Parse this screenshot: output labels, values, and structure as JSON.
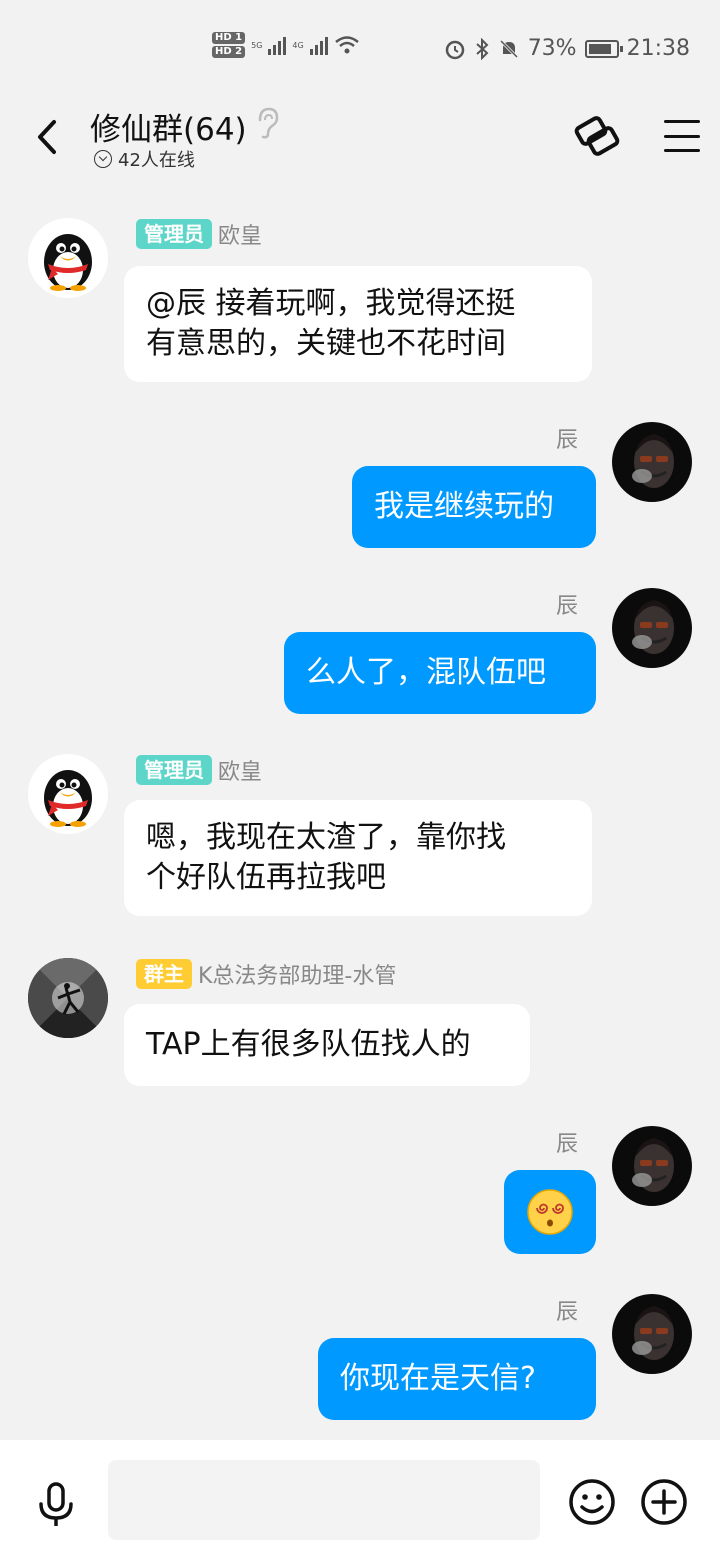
{
  "status_bar": {
    "hd1": "HD 1",
    "hd2": "HD 2",
    "net1": "5G",
    "net2": "4G",
    "battery_percent": "73%",
    "time": "21:38"
  },
  "header": {
    "title": "修仙群(64)",
    "online_text": "42人在线"
  },
  "messages": [
    {
      "sender": "欧皇",
      "badge": "管理员",
      "text_lines": [
        "@辰 接着玩啊，我觉得还挺",
        "有意思的，关键也不花时间"
      ]
    },
    {
      "sender": "辰",
      "text": "我是继续玩的"
    },
    {
      "sender": "辰",
      "text": "么人了，混队伍吧"
    },
    {
      "sender": "欧皇",
      "badge": "管理员",
      "text_lines": [
        "嗯，我现在太渣了，靠你找",
        "个好队伍再拉我吧"
      ]
    },
    {
      "sender": "K总法务部助理-水管",
      "badge": "群主",
      "text": "TAP上有很多队伍找人的"
    },
    {
      "sender": "辰",
      "emoji": "dizzy-face"
    },
    {
      "sender": "辰",
      "text": "你现在是天信?"
    }
  ],
  "input": {
    "placeholder": ""
  },
  "colors": {
    "outgoing_bubble": "#0099ff",
    "admin_badge": "#5dd6c9",
    "owner_badge": "#ffcc33",
    "background": "#f2f2f2"
  }
}
